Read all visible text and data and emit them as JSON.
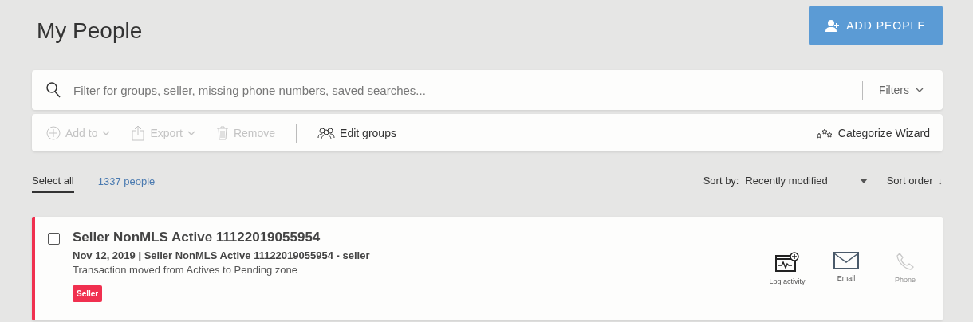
{
  "page": {
    "title": "My People"
  },
  "add_button": {
    "label": "ADD PEOPLE"
  },
  "search": {
    "placeholder": "Filter for groups, seller, missing phone numbers, saved searches...",
    "filters_label": "Filters"
  },
  "toolbar": [
    {
      "kind": "add",
      "label": "Add to",
      "disabled": true,
      "dropdown": true
    },
    {
      "kind": "export",
      "label": "Export",
      "disabled": true,
      "dropdown": true
    },
    {
      "kind": "remove",
      "label": "Remove",
      "disabled": true,
      "dropdown": false
    },
    {
      "kind": "groups",
      "label": "Edit groups",
      "disabled": false,
      "dropdown": false
    }
  ],
  "wizard": {
    "label": "Categorize Wizard"
  },
  "list_bar": {
    "select_all": "Select all",
    "count": "1337 people",
    "sort_by_label": "Sort by:",
    "sort_by_value": "Recently modified",
    "sort_order": "Sort order",
    "sort_order_arrow": "↓"
  },
  "people": [
    {
      "name": "Seller NonMLS Active 11122019055954",
      "checked": false,
      "color": "#f0304f",
      "subtitle": "Nov 12, 2019 | Seller NonMLS Active 11122019055954 - seller",
      "note": "Transaction moved from Actives to Pending zone",
      "tag": "Seller",
      "actions": [
        {
          "kind": "log",
          "label": "Log activity",
          "disabled": false
        },
        {
          "kind": "email",
          "label": "Email",
          "disabled": false
        },
        {
          "kind": "phone",
          "label": "Phone",
          "disabled": true
        }
      ]
    }
  ]
}
